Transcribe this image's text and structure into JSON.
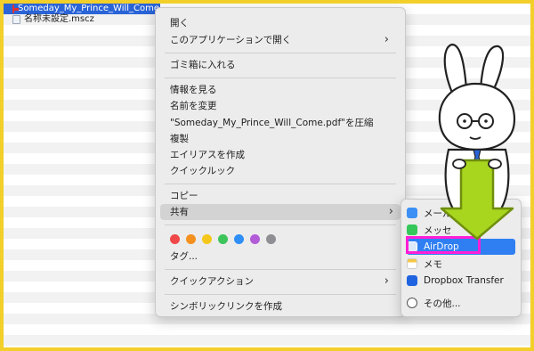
{
  "files": [
    {
      "name": "Someday_My_Prince_Will_Come.pdf",
      "icon": "pdf-icon",
      "selected": true
    },
    {
      "name": "名称未設定.mscz",
      "icon": "mscz-icon",
      "selected": false
    }
  ],
  "menu": {
    "open": "開く",
    "open_with": "このアプリケーションで開く",
    "trash": "ゴミ箱に入れる",
    "get_info": "情報を見る",
    "rename": "名前を変更",
    "compress": "\"Someday_My_Prince_Will_Come.pdf\"を圧縮",
    "duplicate": "複製",
    "make_alias": "エイリアスを作成",
    "quick_look": "クイックルック",
    "copy": "コピー",
    "share": "共有",
    "tags": "タグ...",
    "quick_actions": "クイックアクション",
    "symlink": "シンボリックリンクを作成",
    "tag_colors": [
      "#f04848",
      "#f4901e",
      "#f5c71a",
      "#3dc45a",
      "#2f8ff6",
      "#b35cd8",
      "#8e8e93"
    ]
  },
  "share_menu": {
    "mail": "メール",
    "messages": "メッセ",
    "airdrop": "AirDrop",
    "notes": "メモ",
    "dropbox": "Dropbox Transfer",
    "other": "その他..."
  },
  "colors": {
    "frame": "#f3cf2a",
    "selection": "#2a64d7",
    "airdrop_highlight": "#2f7ff3",
    "annotation_box": "#ff1fd6",
    "arrow": "#a8d51e"
  }
}
